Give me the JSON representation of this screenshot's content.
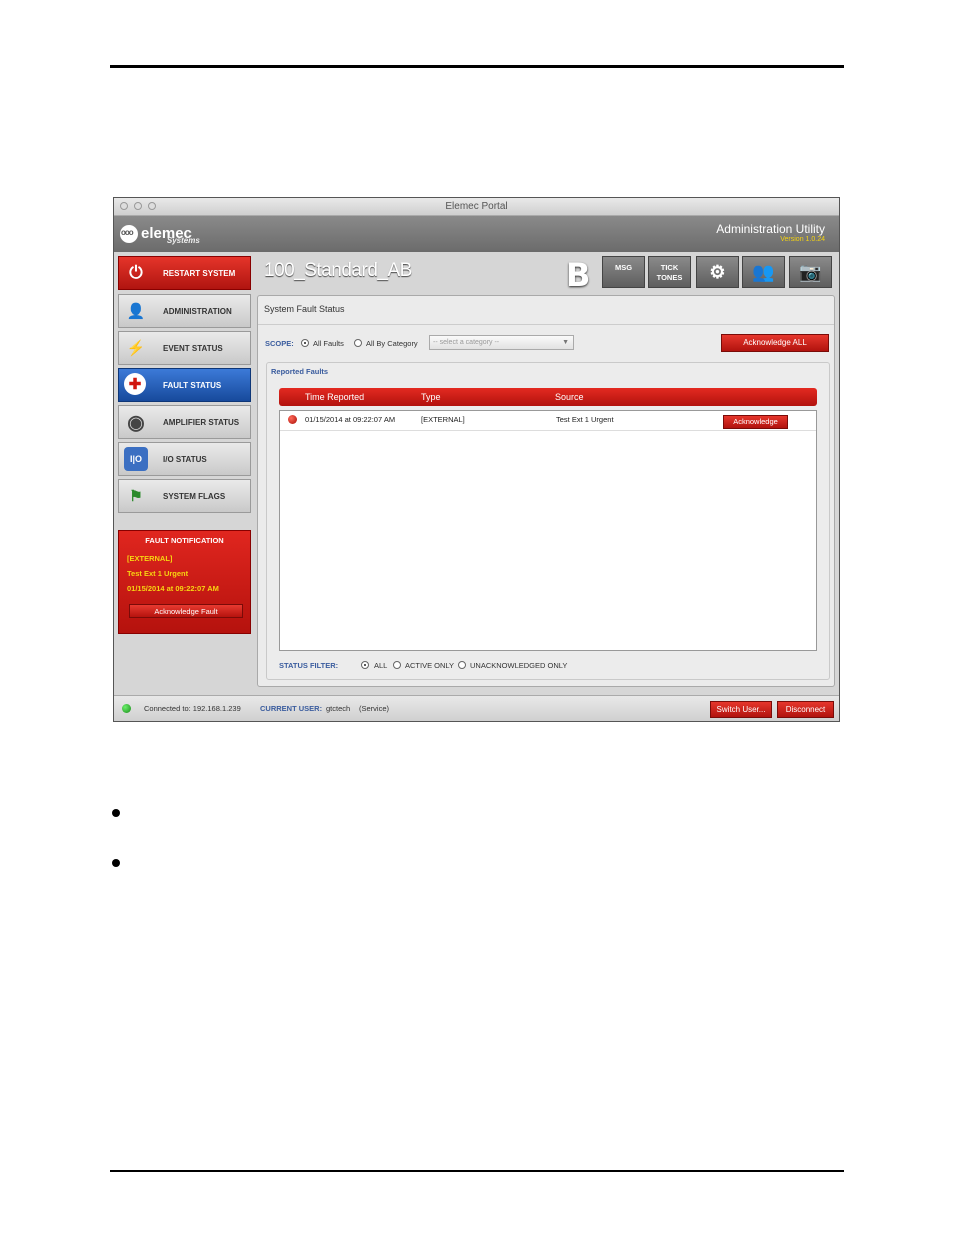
{
  "window": {
    "title": "Elemec Portal"
  },
  "brand": {
    "logo_text": "elemec",
    "logo_sub": "Systems",
    "app_title": "Administration Utility",
    "version": "Version 1.0.24"
  },
  "header": {
    "site_name": "100_Standard_AB",
    "badge": "B"
  },
  "toolbar": [
    {
      "label": "MSG",
      "icon": "msg-icon"
    },
    {
      "label": "TICK\nTONES",
      "icon": "tick-tones-icon"
    },
    {
      "label": "⚙",
      "icon": "gears-icon"
    },
    {
      "label": "👥",
      "icon": "users-icon"
    },
    {
      "label": "📷",
      "icon": "camera-icon"
    }
  ],
  "sidebar": {
    "restart": "RESTART SYSTEM",
    "items": [
      {
        "label": "ADMINISTRATION",
        "icon": "admin-user-icon",
        "glyph": "👤"
      },
      {
        "label": "EVENT STATUS",
        "icon": "lightning-icon",
        "glyph": "⚡"
      },
      {
        "label": "FAULT STATUS",
        "icon": "red-cross-icon",
        "glyph": "✚",
        "active": true
      },
      {
        "label": "AMPLIFIER STATUS",
        "icon": "speaker-icon",
        "glyph": "◉"
      },
      {
        "label": "I/O STATUS",
        "icon": "io-icon",
        "glyph": "I|O"
      },
      {
        "label": "SYSTEM FLAGS",
        "icon": "flags-icon",
        "glyph": "⚑"
      }
    ]
  },
  "notification": {
    "title": "FAULT NOTIFICATION",
    "type": "[EXTERNAL]",
    "source": "Test Ext 1 Urgent",
    "time": "01/15/2014 at 09:22:07 AM",
    "button": "Acknowledge Fault"
  },
  "panel": {
    "title": "System Fault Status",
    "scope_label": "SCOPE:",
    "scope_all": "All Faults",
    "scope_category": "All By Category",
    "select_placeholder": "-- select a category --",
    "ack_all": "Acknowledge ALL",
    "reported_title": "Reported Faults",
    "columns": [
      "Time Reported",
      "Type",
      "Source"
    ],
    "rows": [
      {
        "time": "01/15/2014 at 09:22:07 AM",
        "type": "[EXTERNAL]",
        "source": "Test Ext 1 Urgent",
        "button": "Acknowledge"
      }
    ],
    "filter_label": "STATUS FILTER:",
    "filter_all": "ALL",
    "filter_active": "ACTIVE ONLY",
    "filter_unack": "UNACKNOWLEDGED ONLY"
  },
  "status": {
    "connected": "Connected to: 192.168.1.239",
    "user_label": "CURRENT USER:",
    "user": "gtctech",
    "role": "(Service)",
    "switch_user": "Switch User...",
    "disconnect": "Disconnect"
  }
}
